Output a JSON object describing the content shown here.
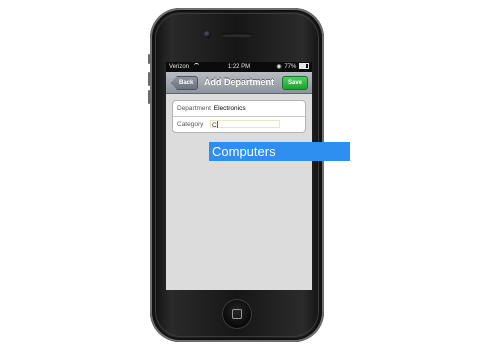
{
  "status_bar": {
    "carrier": "Verizon",
    "time": "1:22 PM",
    "battery": "77%"
  },
  "nav_bar": {
    "back_label": "Back",
    "title": "Add Department",
    "save_label": "Save"
  },
  "form": {
    "department_label": "Department",
    "department_value": "Electronics",
    "category_label": "Category",
    "category_value": "C"
  },
  "autocomplete": {
    "suggestion": "Computers"
  },
  "colors": {
    "save_button": "#1fa130",
    "autocomplete_bg": "#2e8ff0"
  },
  "icons": [
    "wifi-icon",
    "lock-icon",
    "battery-icon",
    "home-button"
  ]
}
